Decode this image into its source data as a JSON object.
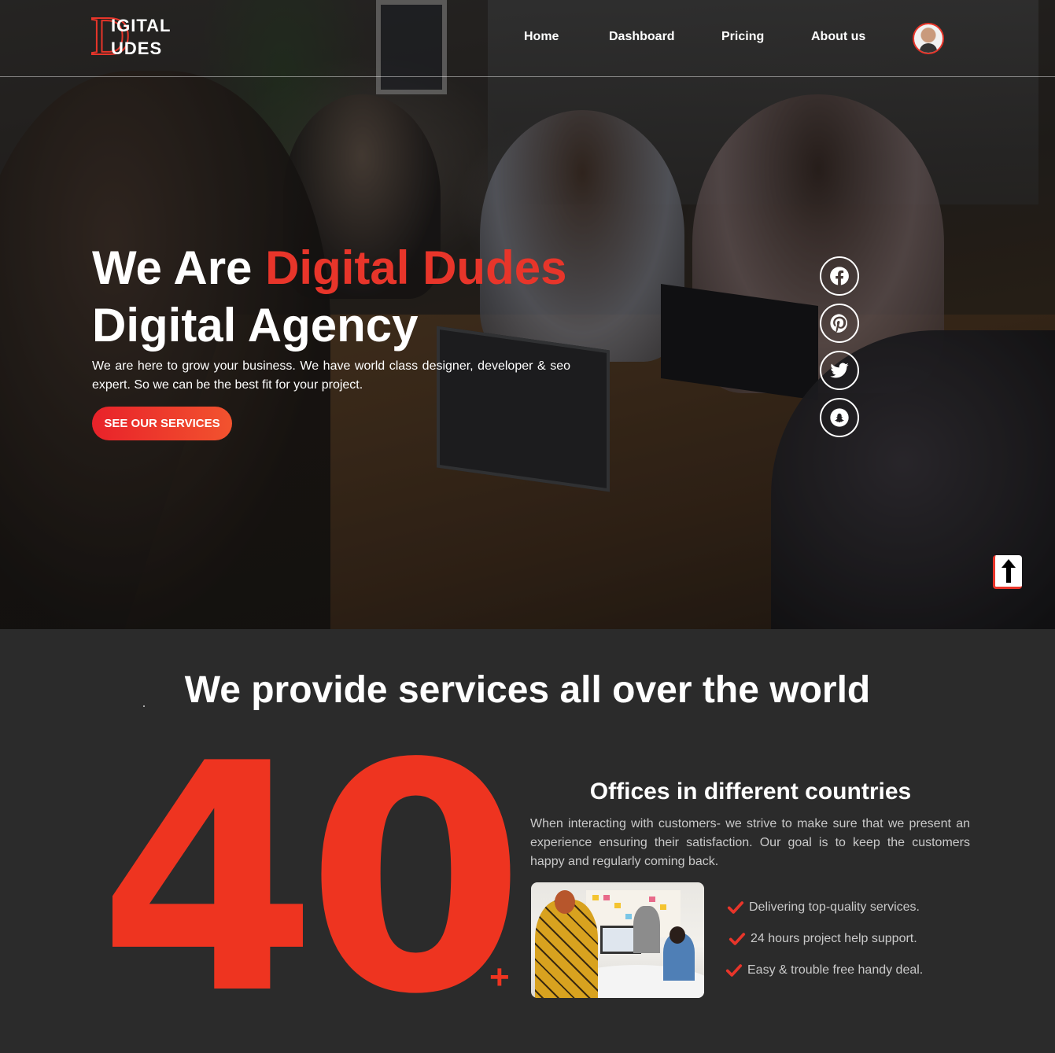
{
  "brand": {
    "logo_letter": "D",
    "logo_line1": "IGITAL",
    "logo_line2": "UDES",
    "accent": "#e8352a"
  },
  "nav": {
    "items": [
      {
        "label": "Home"
      },
      {
        "label": "Dashboard"
      },
      {
        "label": "Pricing"
      },
      {
        "label": "About us"
      }
    ],
    "avatar_icon": "user-avatar"
  },
  "hero": {
    "title_prefix": "We Are ",
    "title_accent": "Digital Dudes",
    "title_line2": "Digital Agency",
    "subtitle": "We are here to grow your business. We have world class designer, developer & seo expert. So we can be the best fit for your project.",
    "cta_label": "SEE OUR SERVICES",
    "social_icons": [
      "facebook-icon",
      "pinterest-icon",
      "twitter-icon",
      "snapchat-icon"
    ],
    "scroll_top_icon": "arrow-up-icon"
  },
  "services": {
    "title": "We provide services all over the world",
    "count": "40",
    "count_suffix": "+",
    "offices_title": "Offices in different countries",
    "offices_desc": "When interacting with customers- we strive to make sure that we present an experience ensuring their satisfaction. Our goal is to keep the customers happy and regularly coming back.",
    "features": [
      {
        "label": "Delivering top-quality services."
      },
      {
        "label": "24 hours project help support."
      },
      {
        "label": "Easy & trouble free handy deal."
      }
    ],
    "check_icon": "check-icon"
  }
}
